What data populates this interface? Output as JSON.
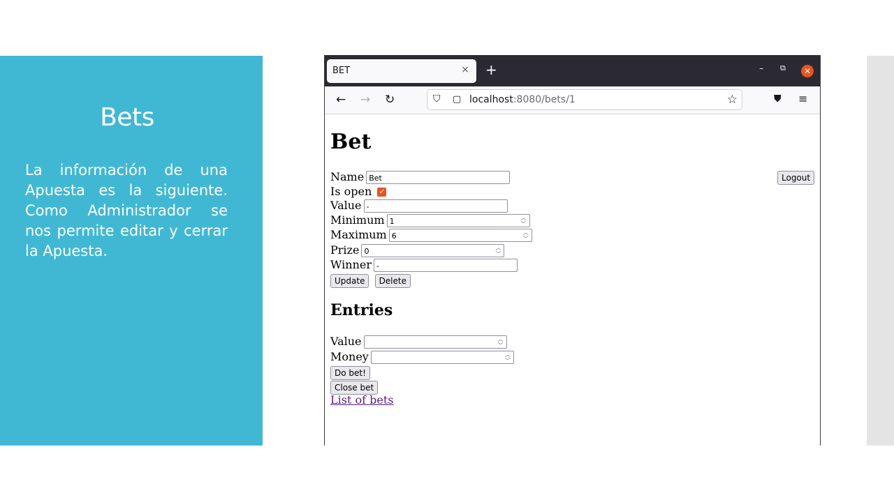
{
  "slide": {
    "title": "Bets",
    "body": "La información de una Apuesta es la siguiente. Como Administrador se nos permite editar y cerrar la Apuesta."
  },
  "browser": {
    "tab_title": "BET",
    "tab_close": "×",
    "new_tab": "+",
    "url_host": "localhost",
    "url_path": ":8080/bets/1"
  },
  "page": {
    "heading": "Bet",
    "logout_label": "Logout",
    "form": {
      "name_label": "Name",
      "name_value": "Bet",
      "is_open_label": "Is open",
      "is_open_checked": true,
      "value_label": "Value",
      "value_value": "-",
      "minimum_label": "Minimum",
      "minimum_value": "1",
      "maximum_label": "Maximum",
      "maximum_value": "6",
      "prize_label": "Prize",
      "prize_value": "0",
      "winner_label": "Winner",
      "winner_value": "-",
      "update_label": "Update",
      "delete_label": "Delete"
    },
    "entries": {
      "heading": "Entries",
      "value_label": "Value",
      "value_value": "",
      "money_label": "Money",
      "money_value": "",
      "do_bet_label": "Do bet!",
      "close_bet_label": "Close bet"
    },
    "list_link": "List of bets"
  },
  "colors": {
    "slide_panel": "#40b8d3",
    "checkbox_accent": "#e95420",
    "visited_link": "#551a8b"
  }
}
